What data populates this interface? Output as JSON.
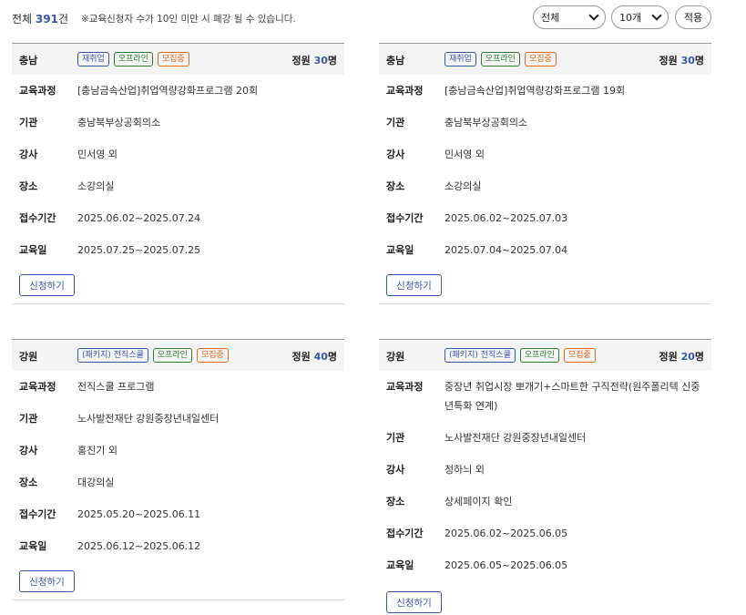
{
  "summary": {
    "total_prefix": "전체 ",
    "total_count": "391",
    "total_suffix": "건",
    "notice": "※교육신청자 수가 10인 미만 시 폐강 될 수 있습니다."
  },
  "filters": {
    "category_selected": "전체",
    "page_size_selected": "10개",
    "apply_label": "적용"
  },
  "labels": {
    "course": "교육과정",
    "org": "기관",
    "instructor": "강사",
    "place": "장소",
    "apply_period": "접수기간",
    "edu_date": "교육일",
    "capacity_prefix": "정원 ",
    "capacity_suffix": "명",
    "apply_button": "신청하기"
  },
  "cards": [
    {
      "region": "충남",
      "badges": [
        "재취업",
        "오프라인",
        "모집중"
      ],
      "capacity": "30",
      "course": "[충남금속산업]취업역량강화프로그램 20회",
      "org": "충남북부상공회의소",
      "instructor": "민서영 외",
      "place": "소강의실",
      "apply_period": "2025.06.02~2025.07.24",
      "edu_date": "2025.07.25~2025.07.25"
    },
    {
      "region": "충남",
      "badges": [
        "재취업",
        "오프라인",
        "모집중"
      ],
      "capacity": "30",
      "course": "[충남금속산업]취업역량강화프로그램 19회",
      "org": "충남북부상공회의소",
      "instructor": "민서영 외",
      "place": "소강의실",
      "apply_period": "2025.06.02~2025.07.03",
      "edu_date": "2025.07.04~2025.07.04"
    },
    {
      "region": "강원",
      "badges": [
        "(패키지) 전직스쿨",
        "오프라인",
        "모집중"
      ],
      "capacity": "40",
      "course": "전직스쿨 프로그램",
      "org": "노사발전재단 강원중장년내일센터",
      "instructor": "홍진기 외",
      "place": "대강의실",
      "apply_period": "2025.05.20~2025.06.11",
      "edu_date": "2025.06.12~2025.06.12"
    },
    {
      "region": "강원",
      "badges": [
        "(패키지) 전직스쿨",
        "오프라인",
        "모집중"
      ],
      "capacity": "20",
      "course": "중장년 취업시장 뽀개기+스마트한 구직전략(원주폴리텍 신중년특화 연계)",
      "org": "노사발전재단 강원중장년내일센터",
      "instructor": "정하늬 외",
      "place": "상세페이지 확인",
      "apply_period": "2025.06.02~2025.06.05",
      "edu_date": "2025.06.05~2025.06.05"
    }
  ]
}
